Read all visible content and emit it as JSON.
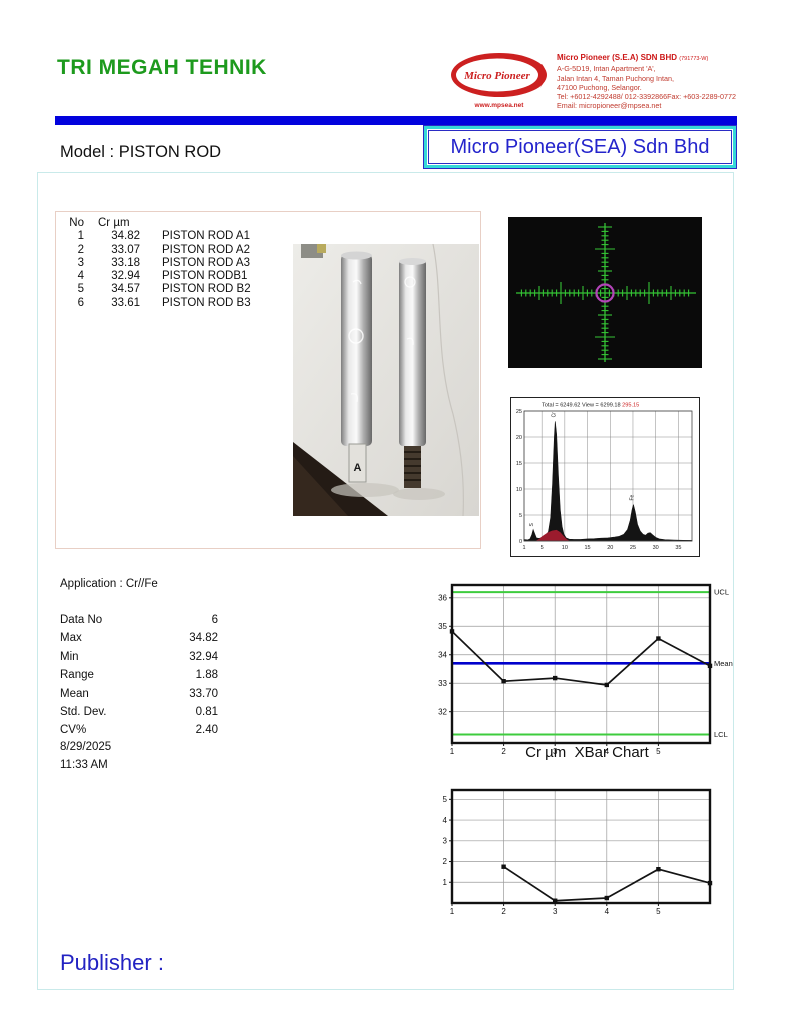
{
  "header": {
    "company_title": "TRI MEGAH TEHNIK",
    "logo": {
      "name": "Micro Pioneer",
      "website": "www.mpsea.net"
    },
    "address": {
      "line1": "Micro Pioneer (S.E.A) SDN BHD",
      "line1_suffix": "(791773-W)",
      "line2": "A-G-5D19, Intan Apartment 'A',",
      "line3": "Jalan Intan 4, Taman Puchong Intan,",
      "line4": "47100 Puchong, Selangor.",
      "line5": "Tel: +6012-4292488/ 012-3392866Fax: +603-2289-0772",
      "line6": "Email: micropioneer@mpsea.net"
    },
    "model_label": "Model : PISTON ROD",
    "company_box": "Micro Pioneer(SEA) Sdn Bhd"
  },
  "measurements": {
    "columns": [
      "No",
      "Cr µm"
    ],
    "rows": [
      {
        "no": "1",
        "value": "34.82",
        "name": "PISTON ROD A1"
      },
      {
        "no": "2",
        "value": "33.07",
        "name": "PISTON ROD A2"
      },
      {
        "no": "3",
        "value": "33.18",
        "name": "PISTON ROD A3"
      },
      {
        "no": "4",
        "value": "32.94",
        "name": "PISTON RODB1"
      },
      {
        "no": "5",
        "value": "34.57",
        "name": "PISTON ROD B2"
      },
      {
        "no": "6",
        "value": "33.61",
        "name": "PISTON ROD B3"
      }
    ]
  },
  "statistics": {
    "application_label": "Application : Cr//Fe",
    "items": [
      {
        "label": "Data No",
        "value": "6"
      },
      {
        "label": "Max",
        "value": "34.82"
      },
      {
        "label": "Min",
        "value": "32.94"
      },
      {
        "label": "Range",
        "value": "1.88"
      },
      {
        "label": "Mean",
        "value": "33.70"
      },
      {
        "label": "Std. Dev.",
        "value": "0.81"
      },
      {
        "label": "CV%",
        "value": "2.40"
      }
    ],
    "date": "8/29/2025",
    "time": "11:33 AM"
  },
  "footer": {
    "publisher_label": "Publisher :"
  },
  "crosshair_display": {
    "background": "#0a0a0a",
    "reticle_color": "#35c435",
    "center_ring_color": "#b344b8"
  },
  "colors": {
    "accent_green": "#1d9a1d",
    "header_bar_blue": "#0202dd",
    "company_box_cyan": "#35d8d8",
    "brand_red": "#cc2020",
    "control_limit_green": "#3ecc3e",
    "mean_line_blue": "#0000cc"
  },
  "chart_data": [
    {
      "type": "area",
      "name": "xrf-spectrum",
      "title": "Total = 6249.62 View = 6299.18",
      "live_time_red": "295.15",
      "xlim": [
        1,
        38
      ],
      "ylim": [
        0,
        25
      ],
      "xticks": [
        1,
        5,
        10,
        15,
        20,
        25,
        30,
        35
      ],
      "yticks": [
        0,
        5,
        10,
        15,
        20,
        25
      ],
      "series_color": "#141414",
      "background_fit_color": "#9b1b2d",
      "points": [
        [
          1,
          0.3
        ],
        [
          1.8,
          0.2
        ],
        [
          2.3,
          0.4
        ],
        [
          2.7,
          1.2
        ],
        [
          3.0,
          2.2
        ],
        [
          3.3,
          1.5
        ],
        [
          3.7,
          0.6
        ],
        [
          4.3,
          0.5
        ],
        [
          5,
          0.7
        ],
        [
          5.8,
          1.0
        ],
        [
          6.4,
          1.8
        ],
        [
          6.9,
          4.5
        ],
        [
          7.3,
          11
        ],
        [
          7.7,
          20
        ],
        [
          7.9,
          23
        ],
        [
          8.2,
          20.5
        ],
        [
          8.6,
          12.5
        ],
        [
          9,
          6
        ],
        [
          9.4,
          2.8
        ],
        [
          9.8,
          1.3
        ],
        [
          10.3,
          0.6
        ],
        [
          11,
          0.35
        ],
        [
          12,
          0.3
        ],
        [
          13.5,
          0.3
        ],
        [
          15,
          0.4
        ],
        [
          16.5,
          0.45
        ],
        [
          18,
          0.55
        ],
        [
          19.5,
          0.6
        ],
        [
          21,
          0.75
        ],
        [
          22,
          0.9
        ],
        [
          23,
          1.3
        ],
        [
          23.8,
          2.2
        ],
        [
          24.4,
          4
        ],
        [
          24.8,
          6
        ],
        [
          25.1,
          7
        ],
        [
          25.5,
          5.6
        ],
        [
          26,
          3.2
        ],
        [
          26.6,
          1.9
        ],
        [
          27.2,
          1.3
        ],
        [
          27.8,
          1.1
        ],
        [
          28.3,
          1.5
        ],
        [
          28.8,
          1.6
        ],
        [
          29.3,
          1.2
        ],
        [
          30,
          0.7
        ],
        [
          30.8,
          0.4
        ],
        [
          32,
          0.25
        ],
        [
          34,
          0.18
        ],
        [
          36,
          0.14
        ],
        [
          38,
          0.12
        ]
      ],
      "fit_points": [
        [
          3.6,
          0.05
        ],
        [
          4.3,
          0.4
        ],
        [
          5.2,
          1.0
        ],
        [
          6.2,
          1.6
        ],
        [
          7.2,
          2.0
        ],
        [
          8.2,
          2.15
        ],
        [
          9,
          1.7
        ],
        [
          9.7,
          1.0
        ],
        [
          10.4,
          0.35
        ],
        [
          11,
          0.05
        ]
      ],
      "peak_labels": [
        {
          "x": 3.0,
          "y": 2.4,
          "label": "S"
        },
        {
          "x": 7.9,
          "y": 23.4,
          "label": "Cr"
        },
        {
          "x": 25.1,
          "y": 7.4,
          "label": "Fe"
        }
      ]
    },
    {
      "type": "line",
      "name": "xbar-chart",
      "xlabel": "Cr µm  XBar Chart",
      "x": [
        1,
        2,
        3,
        4,
        5,
        6
      ],
      "values": [
        34.82,
        33.07,
        33.18,
        32.94,
        34.57,
        33.61
      ],
      "mean": 33.7,
      "ucl": 36.2,
      "lcl": 31.2,
      "labels": {
        "ucl": "UCL",
        "mean": "Mean",
        "lcl": "LCL"
      },
      "xticks": [
        1,
        2,
        3,
        4,
        5
      ],
      "yticks": [
        32,
        33,
        34,
        35,
        36
      ],
      "xlim": [
        1,
        6
      ],
      "ylim": [
        30.9,
        36.45
      ],
      "colors": {
        "series": "#141414",
        "mean": "#0000cc",
        "limits": "#3ecc3e"
      }
    },
    {
      "type": "line",
      "name": "moving-range-chart",
      "x": [
        2,
        3,
        4,
        5,
        6
      ],
      "values": [
        1.75,
        0.11,
        0.24,
        1.63,
        0.96
      ],
      "xticks": [
        1,
        2,
        3,
        4,
        5
      ],
      "yticks": [
        1,
        2,
        3,
        4,
        5
      ],
      "xlim": [
        1,
        6
      ],
      "ylim": [
        0,
        5.45
      ],
      "colors": {
        "series": "#141414"
      }
    }
  ]
}
